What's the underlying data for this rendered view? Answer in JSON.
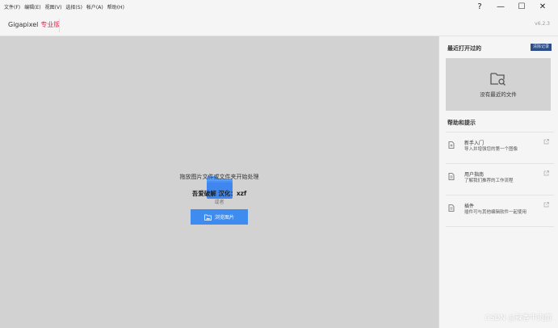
{
  "menu": {
    "items": [
      "文件(F)",
      "编辑(E)",
      "视图(V)",
      "选择(S)",
      "帐户(A)",
      "帮助(H)"
    ]
  },
  "window_controls": {
    "help": "?",
    "minimize": "—",
    "maximize": "☐",
    "close": "✕"
  },
  "header": {
    "brand": "Gigapixel",
    "edition": "专业版",
    "version": "v6.2.3"
  },
  "drop_area": {
    "instruction": "拖放图片文件或文件夹开始处理",
    "credit": "吾爱破解 汉化：xzf",
    "or": "或者",
    "browse_label": "浏览图片"
  },
  "sidebar": {
    "recent_title": "最近打开过的",
    "recent_badge": "清除记录",
    "recent_empty": "没有最近的文件",
    "help_title": "帮助和提示",
    "help_items": [
      {
        "title": "新手入门",
        "desc": "导入并增强您的第一个图像"
      },
      {
        "title": "用户指南",
        "desc": "了解我们推荐的工作流程"
      },
      {
        "title": "插件",
        "desc": "插件可与其他编辑软件一起使用"
      }
    ]
  },
  "watermark": "CSDN @辣香牛肉面",
  "colors": {
    "accent": "#3f8cf0",
    "brand_red": "#e0294f",
    "drop_bg": "#d2d2d2",
    "sidebar_bg": "#f5f5f5"
  },
  "icons": {
    "folder": "folder-icon",
    "browse": "image-folder-icon",
    "recent_empty": "folder-search-icon",
    "help_doc": "document-icon",
    "external": "external-link-icon"
  }
}
